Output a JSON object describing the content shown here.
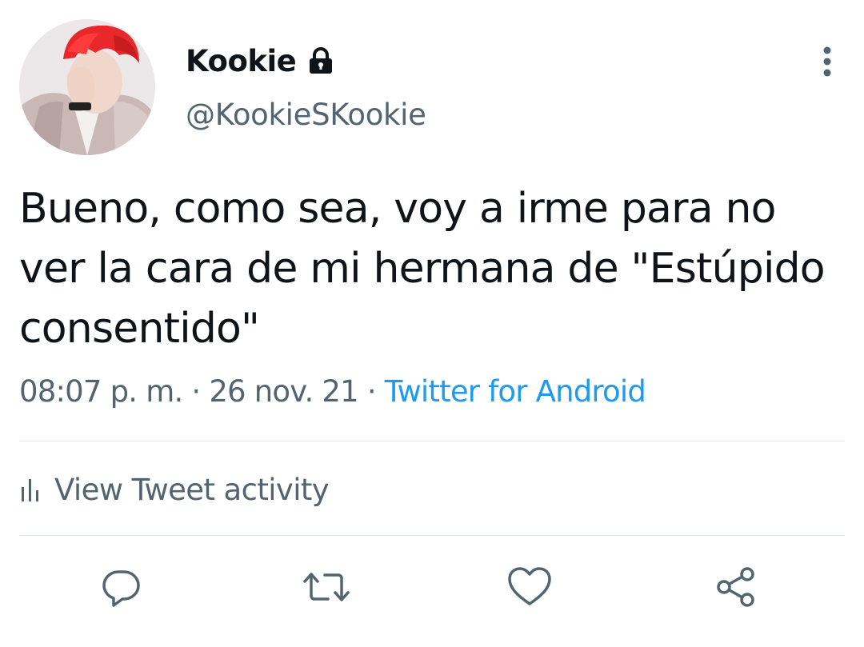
{
  "user": {
    "display_name": "Kookie",
    "handle": "@KookieSKookie",
    "protected_icon": "lock-icon",
    "avatar": "profile-photo"
  },
  "tweet": {
    "text": "Bueno, como sea, voy a irme para no\nver la cara de mi hermana de \"Estúpido\nconsentido\"",
    "time": "08:07 p. m.",
    "separator": "·",
    "date": "26 nov. 21",
    "source": "Twitter for Android"
  },
  "activity": {
    "label": "View Tweet activity",
    "icon": "bar-chart-icon"
  },
  "actions": {
    "reply_icon": "reply-icon",
    "retweet_icon": "retweet-icon",
    "like_icon": "heart-icon",
    "share_icon": "share-icon"
  },
  "colors": {
    "text_primary": "#0f1419",
    "text_secondary": "#536471",
    "link": "#1d9bf0",
    "divider": "#e1e6ea"
  }
}
